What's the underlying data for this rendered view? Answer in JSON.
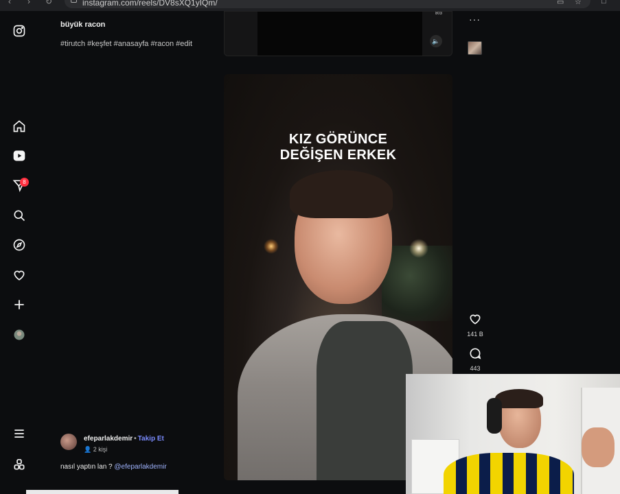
{
  "browser": {
    "url": "instagram.com/reels/DV8sXQ1yIQm/"
  },
  "sidebar": {
    "notification_count": "8"
  },
  "post_top": {
    "title": "büyük racon",
    "hashtags": "#tirutch #keşfet #anasayfa #racon #edit",
    "counter": "803"
  },
  "video": {
    "overlay_line1": "KIZ GÖRÜNCE",
    "overlay_line2": "DEĞİŞEN ERKEK"
  },
  "actions": {
    "likes": "141 B",
    "comments": "443"
  },
  "author": {
    "username": "efeparlakdemir",
    "follow_label": "Takip Et",
    "audience": "2 kişi"
  },
  "comment": {
    "text": "nasıl yaptın lan ?",
    "mention": "@efeparlakdemir"
  }
}
